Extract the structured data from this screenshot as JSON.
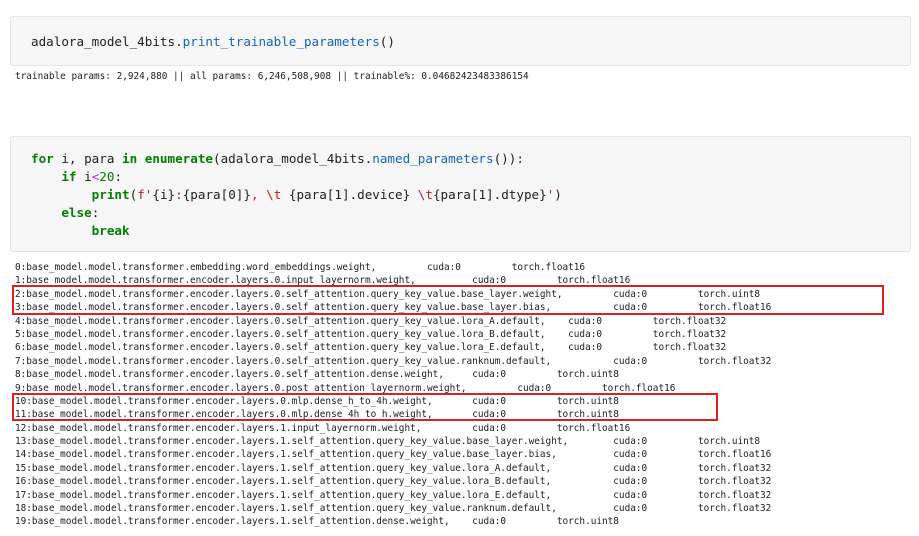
{
  "cell1": {
    "code": {
      "object": "adalora_model_4bits",
      "dot": ".",
      "method": "print_trainable_parameters",
      "call": "()"
    },
    "output": "trainable params: 2,924,880 || all params: 6,246,508,908 || trainable%: 0.04682423483386154"
  },
  "cell2": {
    "code_lines": {
      "l1": {
        "kw_for": "for",
        "vars": " i, para ",
        "kw_in": "in",
        "sp": " ",
        "fn": "enumerate",
        "arg_open": "(adalora_model_4bits.",
        "method": "named_parameters",
        "arg_close": "()):"
      },
      "l2": {
        "indent": "    ",
        "kw_if": "if",
        "cond": " i",
        "op": "<",
        "num": "20",
        "colon": ":"
      },
      "l3": {
        "indent": "        ",
        "fn": "print",
        "open": "(",
        "str1": "f'",
        "expr1": "{i}",
        "str2": ":",
        "expr2": "{para[0]}",
        "str3": ", \\t ",
        "expr3": "{para[1].device}",
        "str4": " \\t",
        "expr4": "{para[1].dtype}",
        "str5": "'",
        "close": ")"
      },
      "l4": {
        "indent": "    ",
        "kw_else": "else",
        "colon": ":"
      },
      "l5": {
        "indent": "        ",
        "kw_break": "break"
      }
    },
    "output_lines": [
      "0:base_model.model.transformer.embedding.word_embeddings.weight,         cuda:0         torch.float16",
      "1:base_model.model.transformer.encoder.layers.0.input_layernorm.weight,          cuda:0         torch.float16",
      "2:base_model.model.transformer.encoder.layers.0.self_attention.query_key_value.base_layer.weight,         cuda:0         torch.uint8",
      "3:base_model.model.transformer.encoder.layers.0.self_attention.query_key_value.base_layer.bias,           cuda:0         torch.float16",
      "4:base_model.model.transformer.encoder.layers.0.self_attention.query_key_value.lora_A.default,    cuda:0         torch.float32",
      "5:base_model.model.transformer.encoder.layers.0.self_attention.query_key_value.lora_B.default,    cuda:0         torch.float32",
      "6:base_model.model.transformer.encoder.layers.0.self_attention.query_key_value.lora_E.default,    cuda:0         torch.float32",
      "7:base_model.model.transformer.encoder.layers.0.self_attention.query_key_value.ranknum.default,           cuda:0         torch.float32",
      "8:base_model.model.transformer.encoder.layers.0.self_attention.dense.weight,     cuda:0         torch.uint8",
      "9:base_model.model.transformer.encoder.layers.0.post_attention_layernorm.weight,         cuda:0         torch.float16",
      "10:base_model.model.transformer.encoder.layers.0.mlp.dense_h_to_4h.weight,       cuda:0         torch.uint8",
      "11:base_model.model.transformer.encoder.layers.0.mlp.dense_4h_to_h.weight,       cuda:0         torch.uint8",
      "12:base_model.model.transformer.encoder.layers.1.input_layernorm.weight,         cuda:0         torch.float16",
      "13:base_model.model.transformer.encoder.layers.1.self_attention.query_key_value.base_layer.weight,        cuda:0         torch.uint8",
      "14:base_model.model.transformer.encoder.layers.1.self_attention.query_key_value.base_layer.bias,          cuda:0         torch.float16",
      "15:base_model.model.transformer.encoder.layers.1.self_attention.query_key_value.lora_A.default,           cuda:0         torch.float32",
      "16:base_model.model.transformer.encoder.layers.1.self_attention.query_key_value.lora_B.default,           cuda:0         torch.float32",
      "17:base_model.model.transformer.encoder.layers.1.self_attention.query_key_value.lora_E.default,           cuda:0         torch.float32",
      "18:base_model.model.transformer.encoder.layers.1.self_attention.query_key_value.ranknum.default,          cuda:0         torch.float32",
      "19:base_model.model.transformer.encoder.layers.1.self_attention.dense.weight,    cuda:0         torch.uint8"
    ]
  },
  "highlight_color": "#e02020"
}
